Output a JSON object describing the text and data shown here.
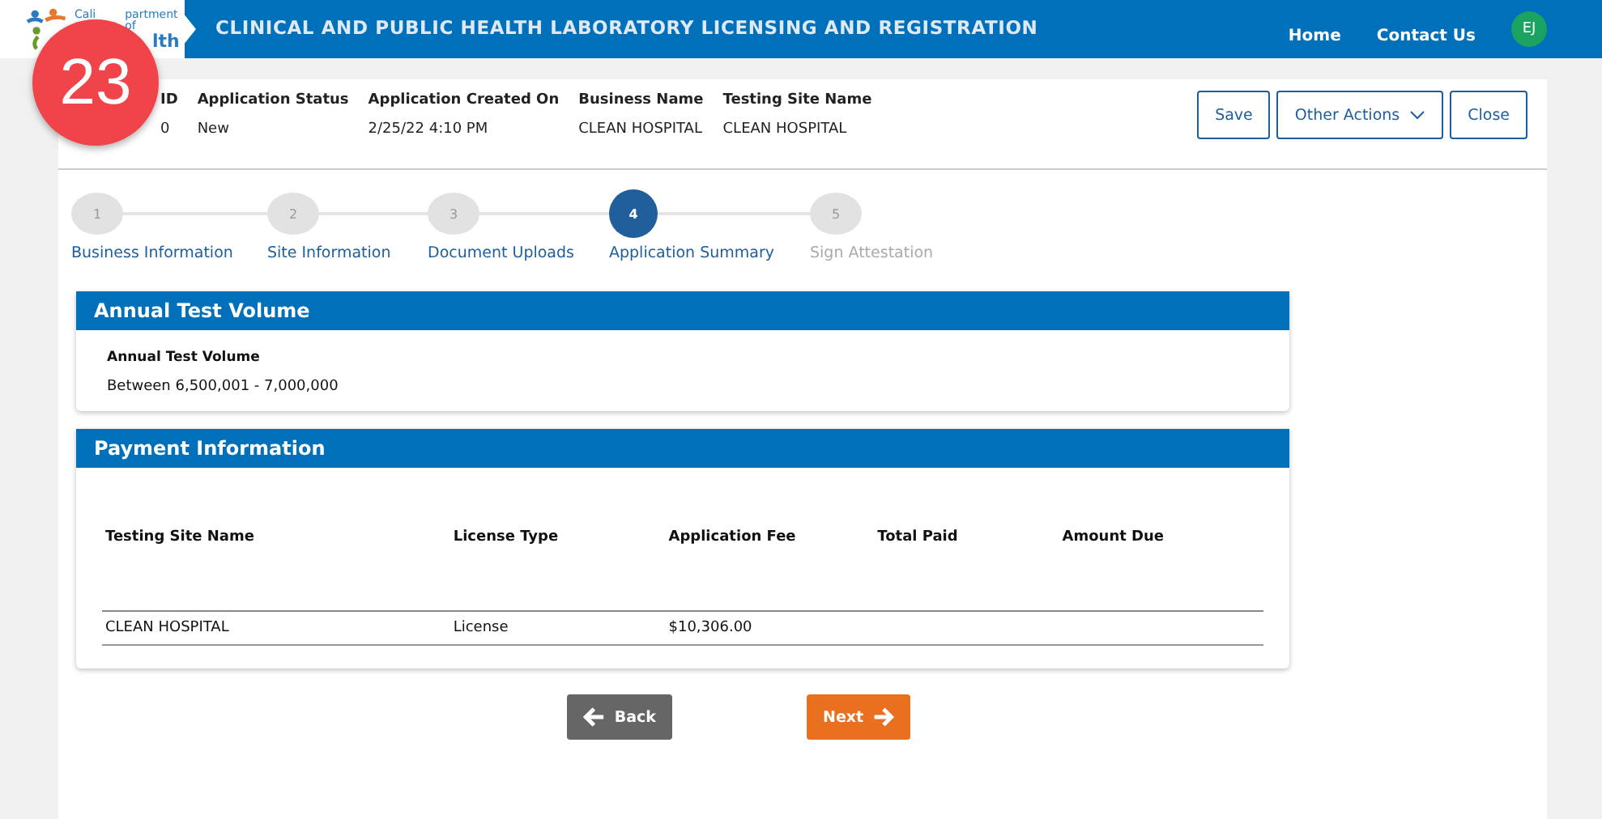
{
  "logo": {
    "line_1": "Cali",
    "line_2": "partment of",
    "line_3": "lth"
  },
  "header": {
    "title": "CLINICAL AND PUBLIC HEALTH LABORATORY LICENSING AND REGISTRATION",
    "nav": [
      "Home",
      "Contact Us"
    ],
    "avatar": "EJ"
  },
  "badge": "23",
  "summary_fields": [
    {
      "label": "ID",
      "value": "0"
    },
    {
      "label": "Application Status",
      "value": "New"
    },
    {
      "label": "Application Created On",
      "value": "2/25/22 4:10 PM"
    },
    {
      "label": "Business Name",
      "value": "CLEAN HOSPITAL"
    },
    {
      "label": "Testing Site Name",
      "value": "CLEAN HOSPITAL"
    }
  ],
  "actions": [
    {
      "label": "Save",
      "kind": "plain"
    },
    {
      "label": "Other Actions",
      "kind": "dropdown"
    },
    {
      "label": "Close",
      "kind": "plain"
    }
  ],
  "steps": [
    {
      "number": "1",
      "label": "Business Information",
      "selected": false,
      "disabled": false
    },
    {
      "number": "2",
      "label": "Site Information",
      "selected": false,
      "disabled": false
    },
    {
      "number": "3",
      "label": "Document Uploads",
      "selected": false,
      "disabled": false
    },
    {
      "number": "4",
      "label": "Application Summary",
      "selected": true,
      "disabled": false
    },
    {
      "number": "5",
      "label": "Sign Attestation",
      "selected": false,
      "disabled": true
    }
  ],
  "volume_card": {
    "title": "Annual Test Volume",
    "field_label": "Annual Test Volume",
    "field_value": "Between 6,500,001 - 7,000,000"
  },
  "payment_card": {
    "title": "Payment Information",
    "columns": [
      "Testing Site Name",
      "License Type",
      "Application Fee",
      "Total Paid",
      "Amount Due"
    ],
    "rows": [
      [
        "CLEAN HOSPITAL",
        "License",
        "$10,306.00",
        "",
        ""
      ]
    ]
  },
  "nav_buttons": [
    {
      "label": "Back",
      "kind": "back"
    },
    {
      "label": "Next",
      "kind": "next"
    }
  ]
}
